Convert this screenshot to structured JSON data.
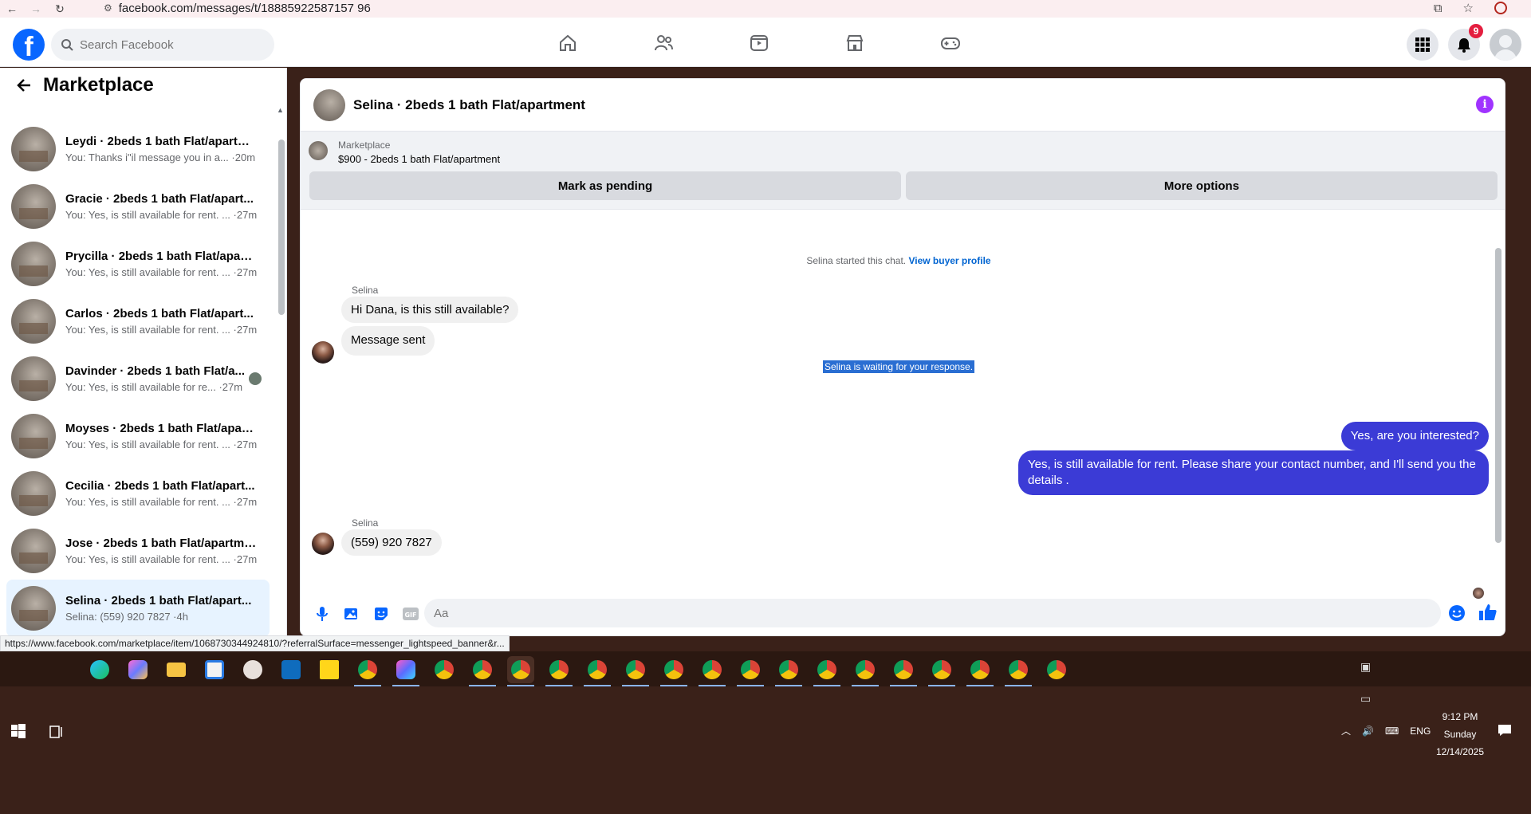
{
  "browser": {
    "url": "facebook.com/messages/t/18885922587157 96",
    "status_link": "https://www.facebook.com/marketplace/item/1068730344924810/?referralSurface=messenger_lightspeed_banner&r..."
  },
  "header": {
    "search_placeholder": "Search Facebook",
    "notifications_count": "9"
  },
  "left": {
    "title": "Marketplace",
    "conversations": [
      {
        "name": "Leydi · 2beds 1 bath Flat/apartm...",
        "sub": "You: Thanks i\"il message you in a... ·20m"
      },
      {
        "name": "Gracie · 2beds 1 bath Flat/apart...",
        "sub": "You: Yes, is still available for rent. ... ·27m"
      },
      {
        "name": "Prycilla · 2beds 1 bath Flat/apart...",
        "sub": "You: Yes, is still available for rent. ... ·27m"
      },
      {
        "name": "Carlos · 2beds 1 bath Flat/apart...",
        "sub": "You: Yes, is still available for rent. ... ·27m"
      },
      {
        "name": "Davinder · 2beds 1 bath Flat/a...",
        "sub": "You: Yes, is still available for re... ·27m"
      },
      {
        "name": "Moyses · 2beds 1 bath Flat/apart...",
        "sub": "You: Yes, is still available for rent. ... ·27m"
      },
      {
        "name": "Cecilia · 2beds 1 bath Flat/apart...",
        "sub": "You: Yes, is still available for rent. ... ·27m"
      },
      {
        "name": "Jose · 2beds 1 bath Flat/apartme...",
        "sub": "You: Yes, is still available for rent. ... ·27m"
      },
      {
        "name": "Selina · 2beds 1 bath Flat/apart...",
        "sub": "Selina: (559) 920 7827 ·4h"
      }
    ]
  },
  "chat": {
    "title": "Selina · 2beds 1 bath Flat/apartment",
    "listing_category": "Marketplace",
    "listing_price": "$900 - 2beds 1 bath Flat/apartment",
    "mark_pending": "Mark as pending",
    "more_options": "More options",
    "started_note": "Selina started this chat.",
    "view_profile": "View buyer profile",
    "sender_name": "Selina",
    "msg1": "Hi Dana, is this still available?",
    "msg2": "Message sent",
    "waiting": "Selina is waiting for your response.",
    "out1": "Yes, are you interested?",
    "out2": "Yes, is still available for rent. Please share your contact number, and I'll send you the details .",
    "msg3": "(559) 920 7827",
    "input_placeholder": "Aa"
  },
  "taskbar": {
    "lang": "ENG",
    "time": "9:12 PM",
    "day": "Sunday",
    "date": "12/14/2025"
  },
  "colors": {
    "fb_blue": "#0866ff",
    "outgoing_bubble": "#3b3bd6",
    "desktop": "#3a2119"
  }
}
